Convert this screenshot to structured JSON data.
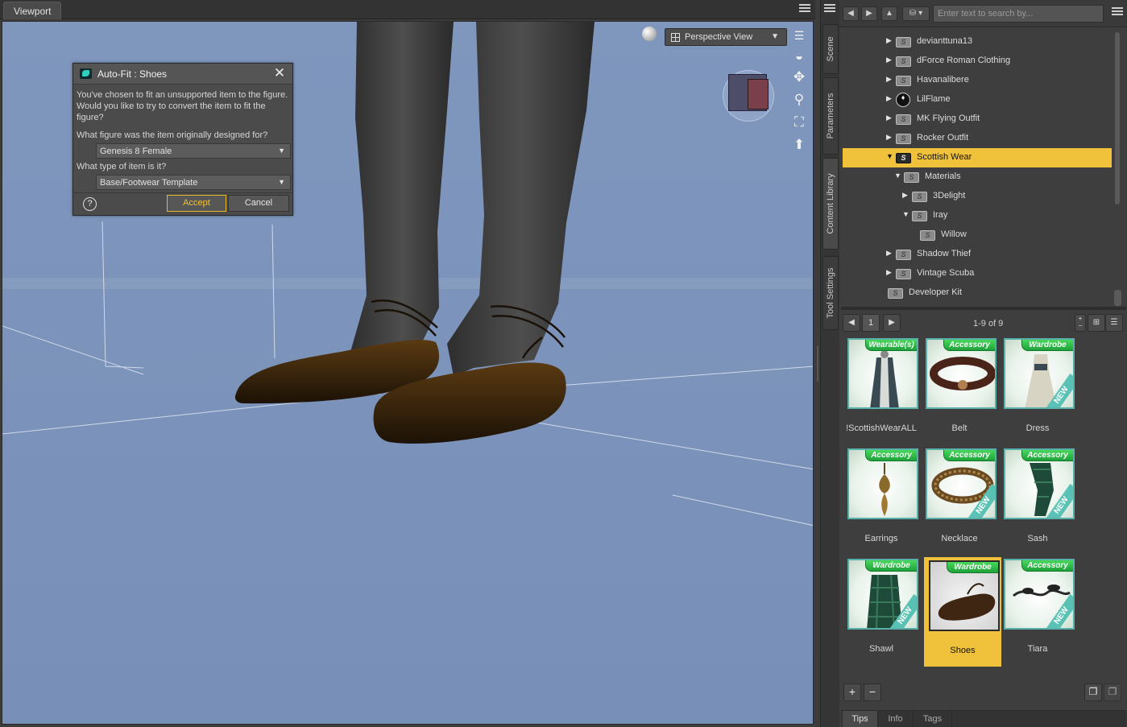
{
  "viewport": {
    "tab_label": "Viewport",
    "view_dropdown": "Perspective View",
    "colors": {
      "background": "#7890b8",
      "ground": "#8aa0c4"
    }
  },
  "dialog": {
    "title": "Auto-Fit : Shoes",
    "message_line1": "You've chosen to fit an unsupported item to the figure.",
    "message_line2": "Would you like to try to convert the item to fit the figure?",
    "question_figure": "What figure was the item originally designed for?",
    "figure_value": "Genesis 8 Female",
    "question_type": "What type of item is it?",
    "type_value": "Base/Footwear Template",
    "accept_label": "Accept",
    "cancel_label": "Cancel",
    "help_glyph": "?",
    "close_glyph": "✕"
  },
  "side_tabs": [
    "Scene",
    "Parameters",
    "Content Library",
    "Tool Settings"
  ],
  "library": {
    "search_placeholder": "Enter text to search by...",
    "tree": [
      {
        "label": "devianttuna13",
        "expanded": false
      },
      {
        "label": "dForce Roman Clothing",
        "expanded": false
      },
      {
        "label": "Havanalibere",
        "expanded": false
      },
      {
        "label": "LilFlame",
        "expanded": false
      },
      {
        "label": "MK Flying Outfit",
        "expanded": false
      },
      {
        "label": "Rocker Outfit",
        "expanded": false
      },
      {
        "label": "Scottish Wear",
        "expanded": true,
        "selected": true
      },
      {
        "label": "Materials",
        "expanded": true
      },
      {
        "label": "3Delight",
        "expanded": false
      },
      {
        "label": "Iray",
        "expanded": true
      },
      {
        "label": "Willow"
      },
      {
        "label": "Shadow Thief",
        "expanded": false
      },
      {
        "label": "Vintage Scuba",
        "expanded": false
      },
      {
        "label": "Developer Kit"
      }
    ],
    "page_number": "1",
    "count": "1-9 of 9",
    "items": [
      {
        "label": "!ScottishWearALL",
        "badge": "Wearable(s)",
        "new": false,
        "icon": "outfit-icon"
      },
      {
        "label": "Belt",
        "badge": "Accessory",
        "new": false,
        "icon": "belt-icon"
      },
      {
        "label": "Dress",
        "badge": "Wardrobe",
        "new": true,
        "icon": "dress-icon"
      },
      {
        "label": "Earrings",
        "badge": "Accessory",
        "new": false,
        "icon": "earring-icon"
      },
      {
        "label": "Necklace",
        "badge": "Accessory",
        "new": true,
        "icon": "necklace-icon"
      },
      {
        "label": "Sash",
        "badge": "Accessory",
        "new": true,
        "icon": "sash-icon"
      },
      {
        "label": "Shawl",
        "badge": "Wardrobe",
        "new": true,
        "icon": "shawl-icon"
      },
      {
        "label": "Shoes",
        "badge": "Wardrobe",
        "new": false,
        "selected": true,
        "icon": "shoes-icon"
      },
      {
        "label": "Tiara",
        "badge": "Accessory",
        "new": true,
        "icon": "tiara-icon"
      }
    ],
    "new_badge_text": "NEW",
    "footer_tabs": [
      "Tips",
      "Info",
      "Tags"
    ],
    "accent_color": "#f0c23c"
  }
}
